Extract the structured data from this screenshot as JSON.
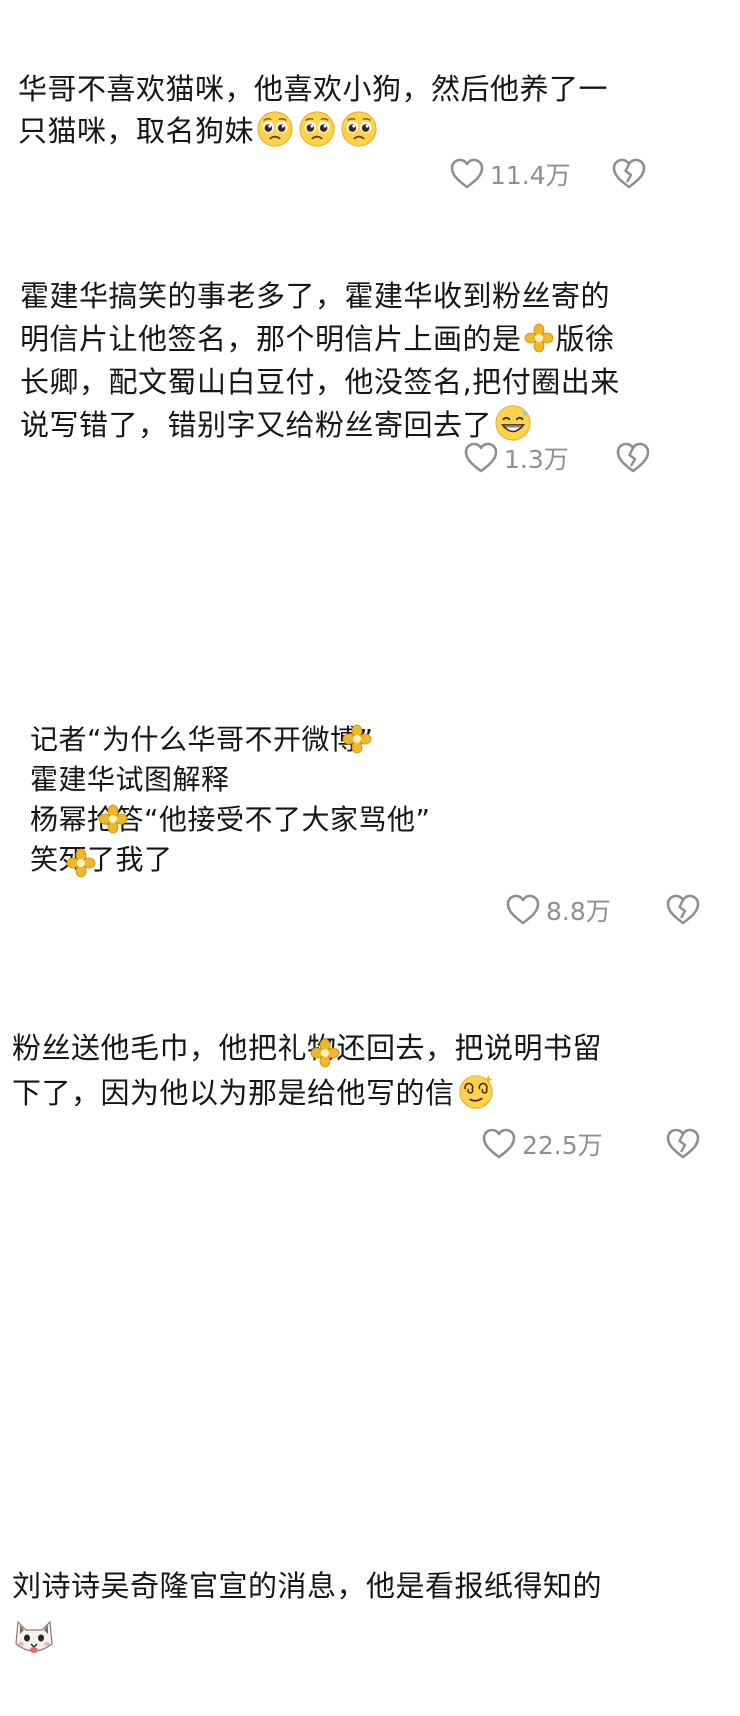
{
  "comments": [
    {
      "lines": [
        "华哥不喜欢猫咪，他喜欢小狗，然后他养了一",
        "只猫咪，取名狗妹"
      ],
      "emojis": [
        "pleading-face",
        "pleading-face",
        "pleading-face"
      ],
      "likes": "11.4万"
    },
    {
      "lines": [
        "霍建华搞笑的事老多了，霍建华收到粉丝寄的",
        "明信片让他签名，那个明信片上画的是",
        "版徐",
        "长卿，配文蜀山白豆付，他没签名,把付圈出来",
        "说写错了，错别字又给粉丝寄回去了"
      ],
      "emojis": [
        "flower-sticker",
        "grinning-sweat-face"
      ],
      "likes": "1.3万"
    },
    {
      "lines": [
        "记者“为什么华哥不开微博”",
        "霍建华试图解释",
        "杨幂抢答“他接受不了大家骂他”",
        "笑死了我了"
      ],
      "emojis": [
        "flower-sticker",
        "flower-sticker",
        "flower-sticker"
      ],
      "likes": "8.8万"
    },
    {
      "lines": [
        "粉丝送他毛巾，他把礼物还回去，把说明书留",
        "下了，因为他以为那是给他写的信"
      ],
      "emojis": [
        "flower-sticker",
        "dizzy-face"
      ],
      "likes": "22.5万"
    },
    {
      "lines": [
        "刘诗诗吴奇隆官宣的消息，他是看报纸得知的"
      ],
      "emojis": [
        "cat-face"
      ]
    }
  ],
  "colors": {
    "text": "#161616",
    "meta": "#8f8f8f",
    "background": "#ffffff"
  }
}
